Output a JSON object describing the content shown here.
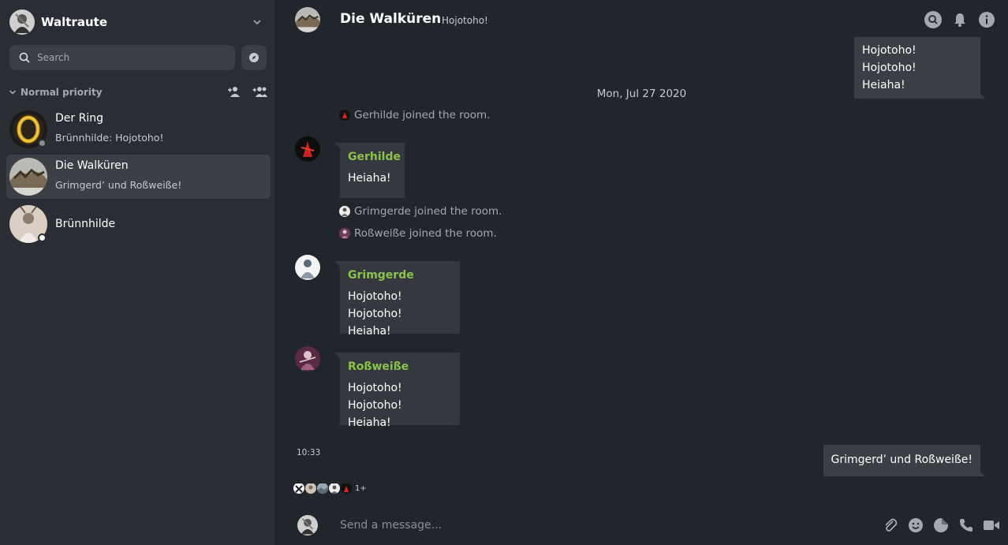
{
  "user": {
    "name": "Waltraute"
  },
  "search": {
    "placeholder": "Search"
  },
  "sidebar": {
    "section_label": "Normal priority",
    "rooms": [
      {
        "name": "Der Ring",
        "preview": "Brünnhilde: Hojotoho!"
      },
      {
        "name": "Die Walküren",
        "preview": "Grimgerd’ und Roßweiße!"
      },
      {
        "name": "Brünnhilde",
        "preview": ""
      }
    ]
  },
  "room": {
    "name": "Die Walküren",
    "topic": "Hojotoho!"
  },
  "timeline": {
    "top_bubble": {
      "line1": "Hojotoho! Hojotoho!",
      "line2": "Heiaha!"
    },
    "date_separator": "Mon, Jul 27 2020",
    "events": [
      "Gerhilde joined the room.",
      "Grimgerde joined the room.",
      "Roßweiße joined the room."
    ],
    "messages": [
      {
        "sender": "Gerhilde",
        "line1": "Heiaha!",
        "line2": ""
      },
      {
        "sender": "Grimgerde",
        "line1": "Hojotoho! Hojotoho!",
        "line2": "Heiaha!"
      },
      {
        "sender": "Roßweiße",
        "line1": "Hojotoho! Hojotoho!",
        "line2": "Heiaha!"
      }
    ],
    "time": "10:33",
    "own_message": "Grimgerd’ und Roßweiße!",
    "read_more": "1+"
  },
  "composer": {
    "placeholder": "Send a message..."
  },
  "colors": {
    "sender": "#8bc34a",
    "sidebar_bg": "#2a2e34",
    "main_bg": "#21262c",
    "bubble": "#3b3f45",
    "selected_room": "#3c4046"
  },
  "icons": [
    "chevron-down-icon",
    "search-icon",
    "compass-icon",
    "add-person-icon",
    "add-group-icon",
    "bell-icon",
    "info-icon",
    "paperclip-icon",
    "emoji-icon",
    "sticker-icon",
    "phone-icon",
    "video-icon"
  ]
}
